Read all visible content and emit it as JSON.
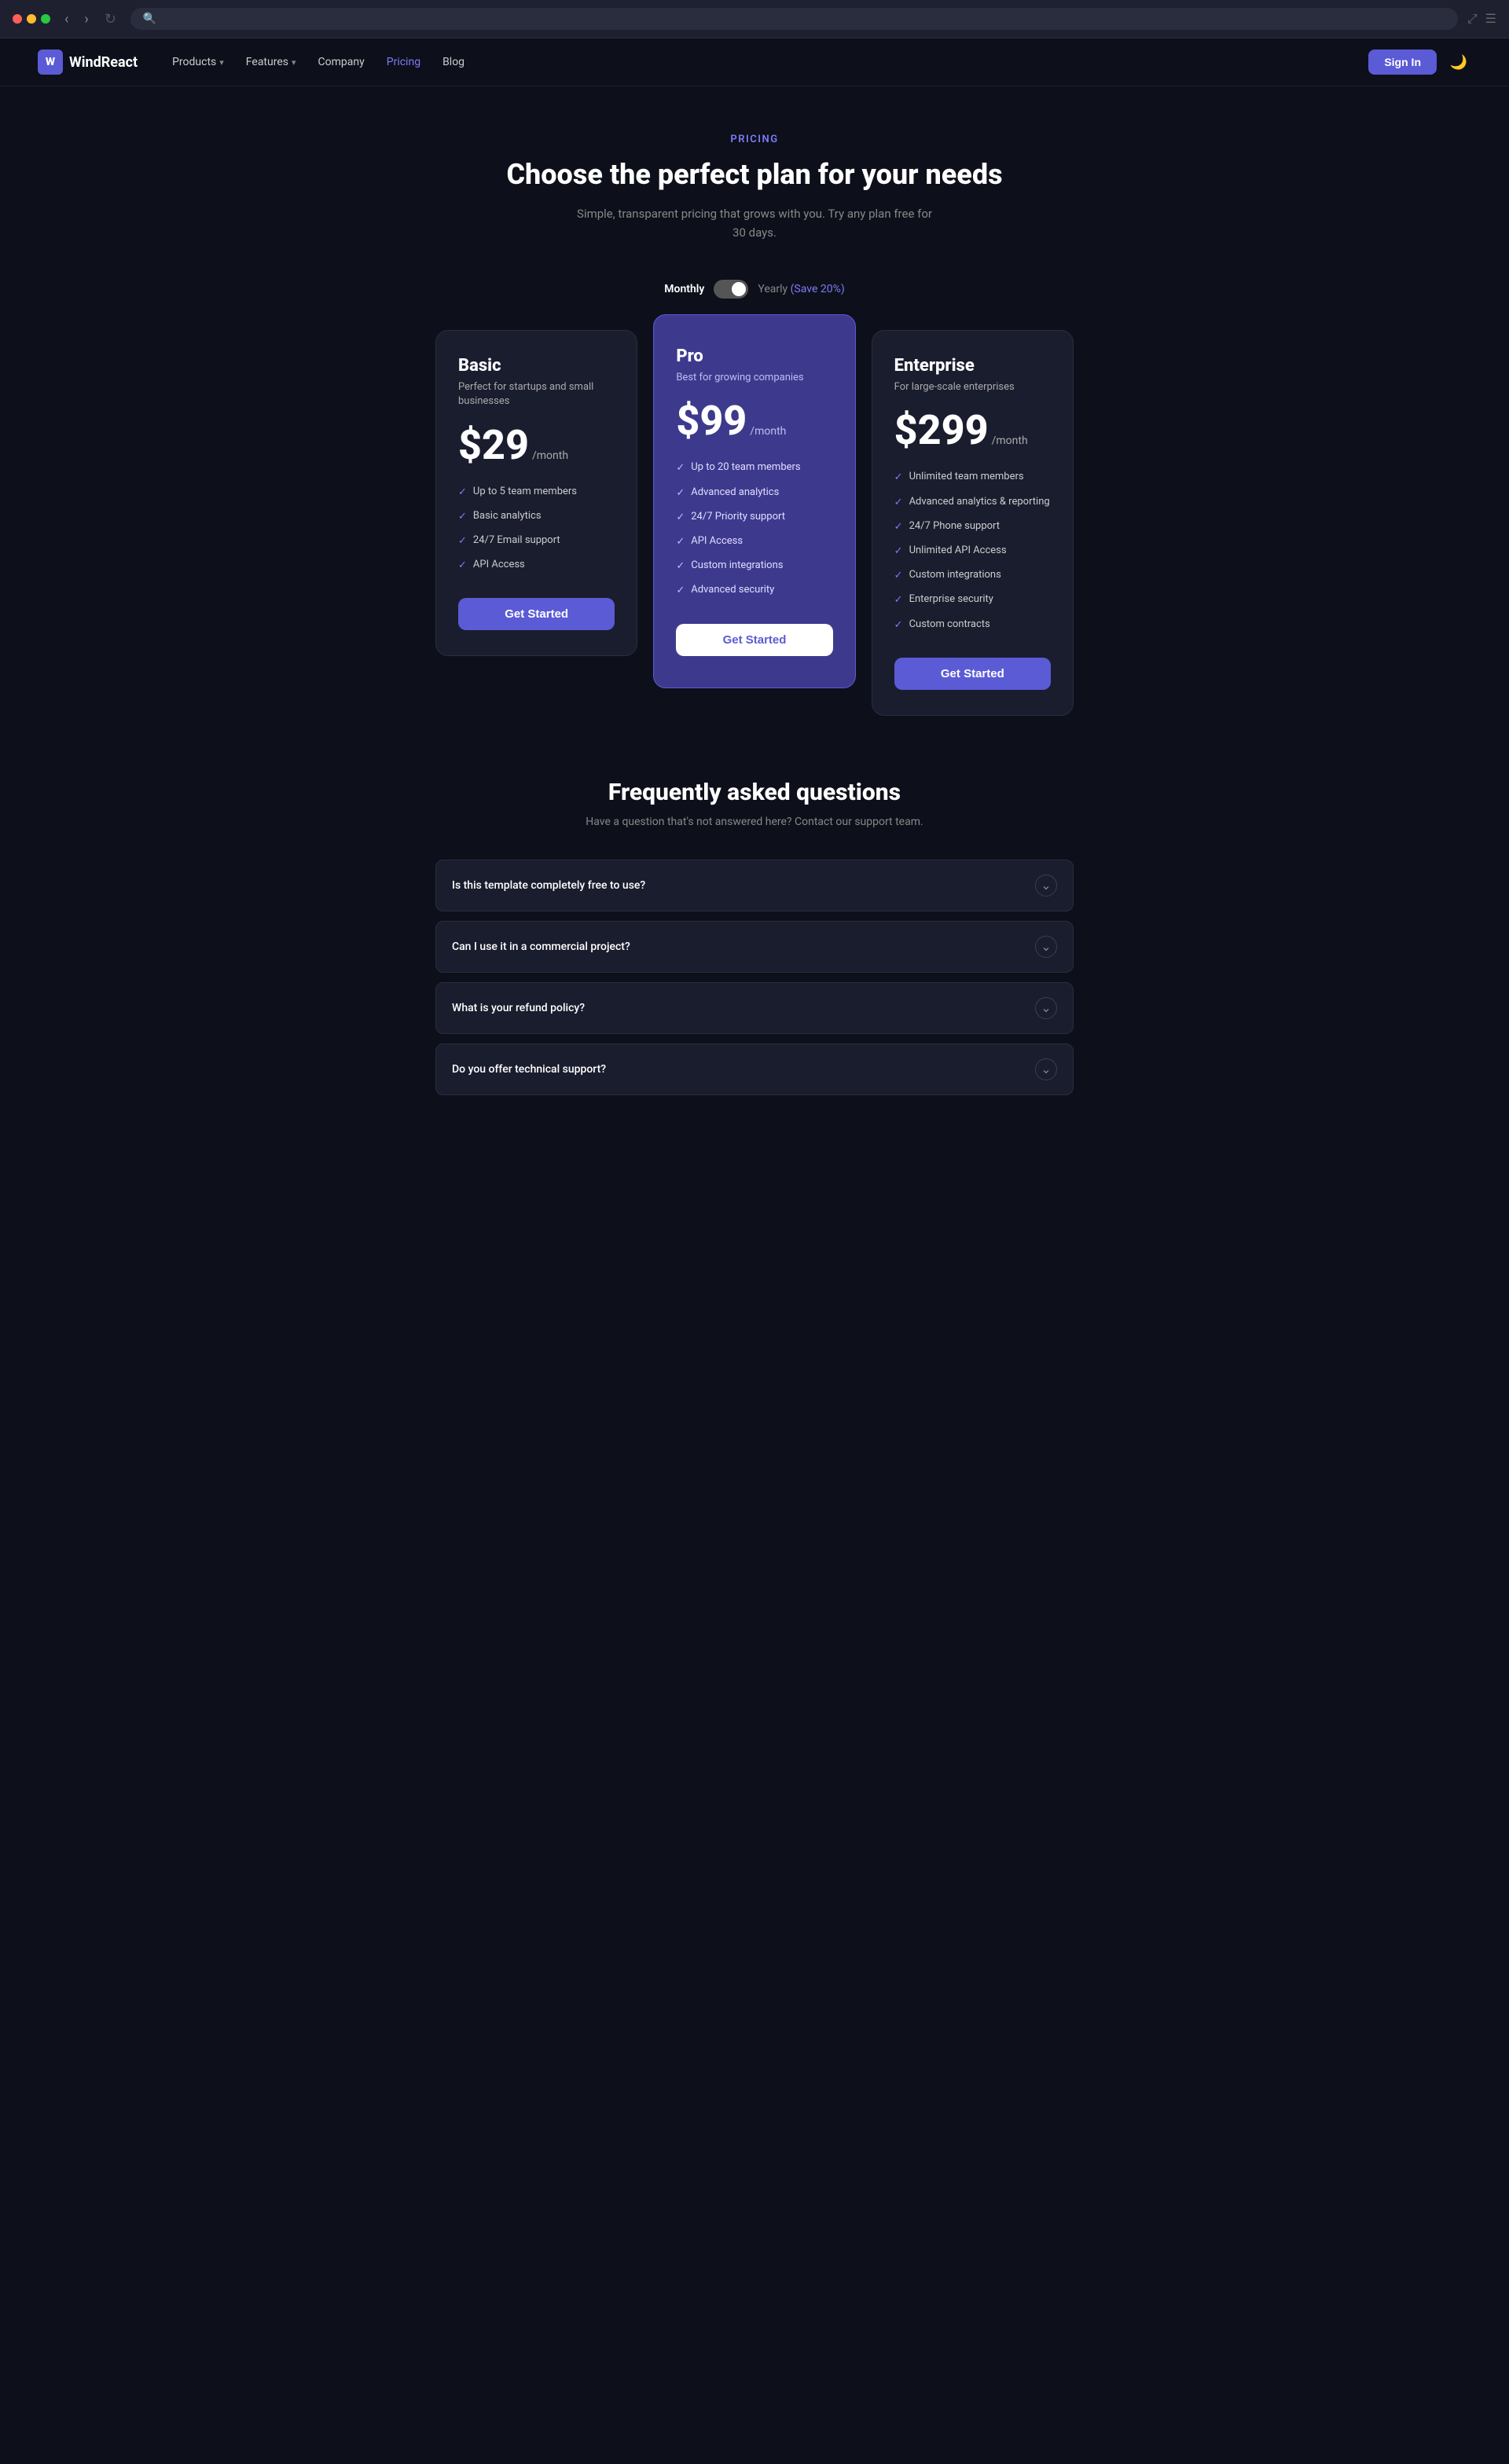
{
  "browser": {
    "address_placeholder": ""
  },
  "navbar": {
    "logo_letter": "W",
    "logo_text": "WindReact",
    "links": [
      {
        "label": "Products",
        "has_dropdown": true,
        "active": false
      },
      {
        "label": "Features",
        "has_dropdown": true,
        "active": false
      },
      {
        "label": "Company",
        "has_dropdown": false,
        "active": false
      },
      {
        "label": "Pricing",
        "has_dropdown": false,
        "active": true
      },
      {
        "label": "Blog",
        "has_dropdown": false,
        "active": false
      }
    ],
    "signin_label": "Sign In",
    "dark_mode_icon": "🌙"
  },
  "hero": {
    "label": "PRICING",
    "title": "Choose the perfect plan for your needs",
    "subtitle": "Simple, transparent pricing that grows with you. Try any plan free for\n30 days."
  },
  "billing": {
    "monthly_label": "Monthly",
    "yearly_label": "Yearly",
    "save_label": "(Save 20%)"
  },
  "plans": [
    {
      "name": "Basic",
      "desc": "Perfect for startups and small businesses",
      "price": "$29",
      "period": "/month",
      "featured": false,
      "features": [
        "Up to 5 team members",
        "Basic analytics",
        "24/7 Email support",
        "API Access"
      ],
      "cta": "Get Started"
    },
    {
      "name": "Pro",
      "desc": "Best for growing companies",
      "price": "$99",
      "period": "/month",
      "featured": true,
      "features": [
        "Up to 20 team members",
        "Advanced analytics",
        "24/7 Priority support",
        "API Access",
        "Custom integrations",
        "Advanced security"
      ],
      "cta": "Get Started"
    },
    {
      "name": "Enterprise",
      "desc": "For large-scale enterprises",
      "price": "$299",
      "period": "/month",
      "featured": false,
      "features": [
        "Unlimited team members",
        "Advanced analytics & reporting",
        "24/7 Phone support",
        "Unlimited API Access",
        "Custom integrations",
        "Enterprise security",
        "Custom contracts"
      ],
      "cta": "Get Started"
    }
  ],
  "faq": {
    "title": "Frequently asked questions",
    "subtitle": "Have a question that's not answered here? Contact our support team.",
    "items": [
      {
        "question": "Is this template completely free to use?"
      },
      {
        "question": "Can I use it in a commercial project?"
      },
      {
        "question": "What is your refund policy?"
      },
      {
        "question": "Do you offer technical support?"
      }
    ]
  }
}
